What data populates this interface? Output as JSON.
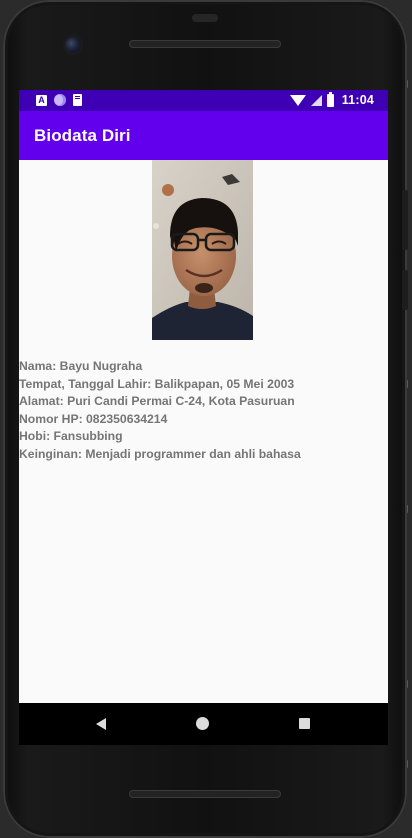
{
  "status_bar": {
    "notification_icons": [
      "android-a-icon",
      "circle-app-icon",
      "sd-card-icon"
    ],
    "system_icons": [
      "wifi-icon",
      "cell-signal-icon",
      "battery-icon"
    ],
    "time": "11:04",
    "color": "#3f00b5"
  },
  "app_bar": {
    "title": "Biodata Diri",
    "color": "#6200ee"
  },
  "profile": {
    "photo_icon": "profile-photo",
    "lines": [
      "Nama: Bayu Nugraha",
      "Tempat, Tanggal Lahir: Balikpapan, 05 Mei 2003",
      "Alamat: Puri Candi Permai C-24, Kota Pasuruan",
      "Nomor HP: 082350634214",
      "Hobi: Fansubbing",
      "Keinginan: Menjadi programmer dan ahli bahasa"
    ]
  },
  "nav_bar": {
    "icons": [
      "back-icon",
      "home-icon",
      "recents-icon"
    ]
  }
}
